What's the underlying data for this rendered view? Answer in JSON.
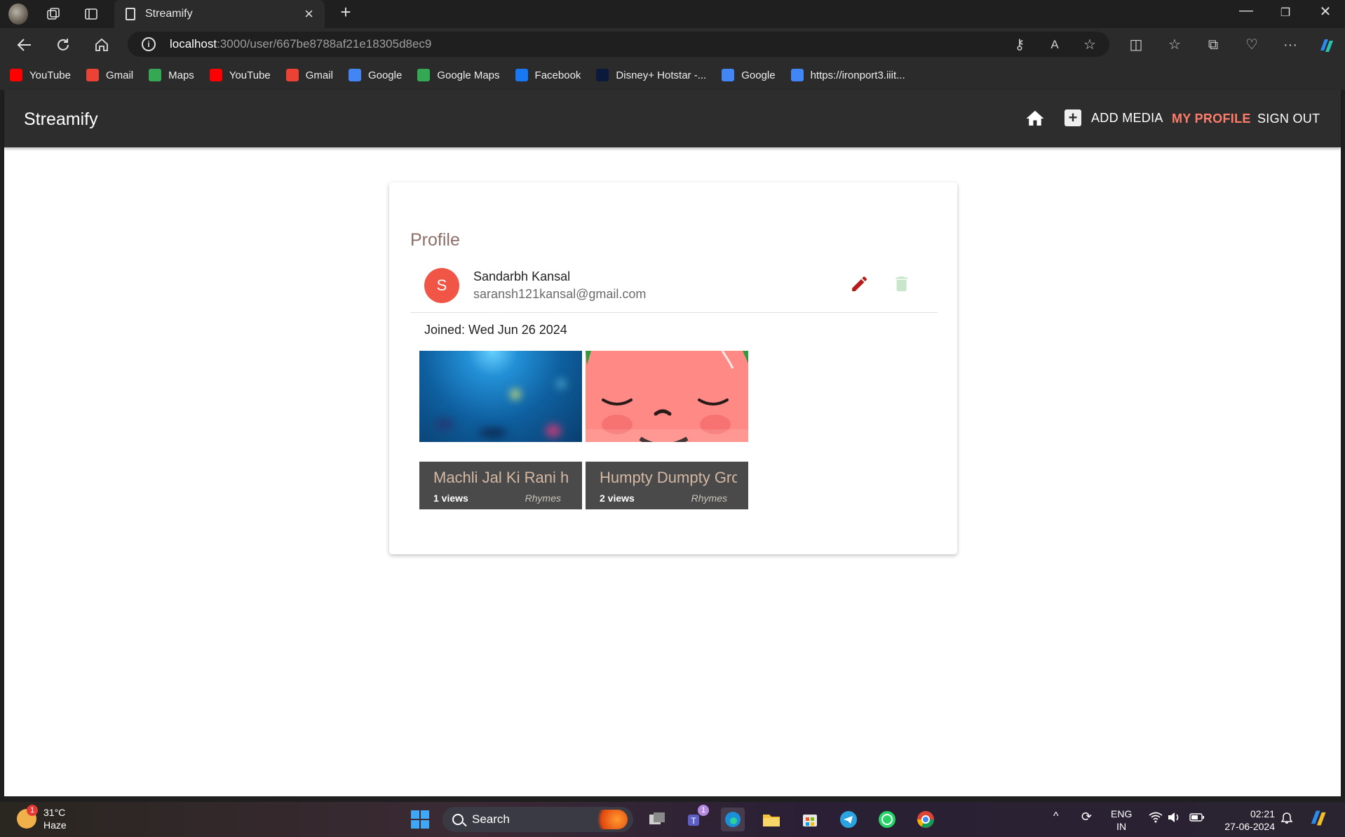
{
  "browser": {
    "tab_title": "Streamify",
    "url_host": "localhost",
    "url_path": ":3000/user/667be8788af21e18305d8ec9",
    "bookmarks": [
      {
        "label": "YouTube",
        "icon": "youtube-icon",
        "color": "#ff0000"
      },
      {
        "label": "Gmail",
        "icon": "gmail-icon",
        "color": "#ea4335"
      },
      {
        "label": "Maps",
        "icon": "maps-icon",
        "color": "#34a853"
      },
      {
        "label": "YouTube",
        "icon": "youtube-icon",
        "color": "#ff0000"
      },
      {
        "label": "Gmail",
        "icon": "gmail-icon",
        "color": "#ea4335"
      },
      {
        "label": "Google",
        "icon": "google-icon",
        "color": "#4285f4"
      },
      {
        "label": "Google Maps",
        "icon": "google-maps-icon",
        "color": "#34a853"
      },
      {
        "label": "Facebook",
        "icon": "facebook-icon",
        "color": "#1877f2"
      },
      {
        "label": "Disney+ Hotstar -...",
        "icon": "hotstar-icon",
        "color": "#0b1a3a"
      },
      {
        "label": "Google",
        "icon": "google-icon",
        "color": "#4285f4"
      },
      {
        "label": "https://ironport3.iiit...",
        "icon": "google-icon",
        "color": "#4285f4"
      }
    ]
  },
  "app": {
    "brand": "Streamify",
    "nav": {
      "add_media": "ADD MEDIA",
      "my_profile": "MY PROFILE",
      "sign_out": "SIGN OUT"
    },
    "colors": {
      "appbar": "#2d2d2d",
      "active_nav": "#ff7c6b",
      "avatar": "#f05545",
      "edit": "#b71c1c",
      "delete": "#c8e6c9"
    }
  },
  "profile": {
    "heading": "Profile",
    "avatar_letter": "S",
    "name": "Sandarbh Kansal",
    "email": "saransh121kansal@gmail.com",
    "joined": "Joined: Wed Jun 26 2024",
    "media": [
      {
        "title": "Machli Jal Ki Rani h",
        "views": "1 views",
        "genre": "Rhymes"
      },
      {
        "title": "Humpty Dumpty Gro",
        "views": "2 views",
        "genre": "Rhymes"
      }
    ]
  },
  "taskbar": {
    "temperature": "31°C",
    "weather": "Haze",
    "weather_badge": "1",
    "search": "Search",
    "teams_badge": "1",
    "lang": "ENG",
    "region": "IN",
    "time": "02:21",
    "date": "27-06-2024"
  }
}
